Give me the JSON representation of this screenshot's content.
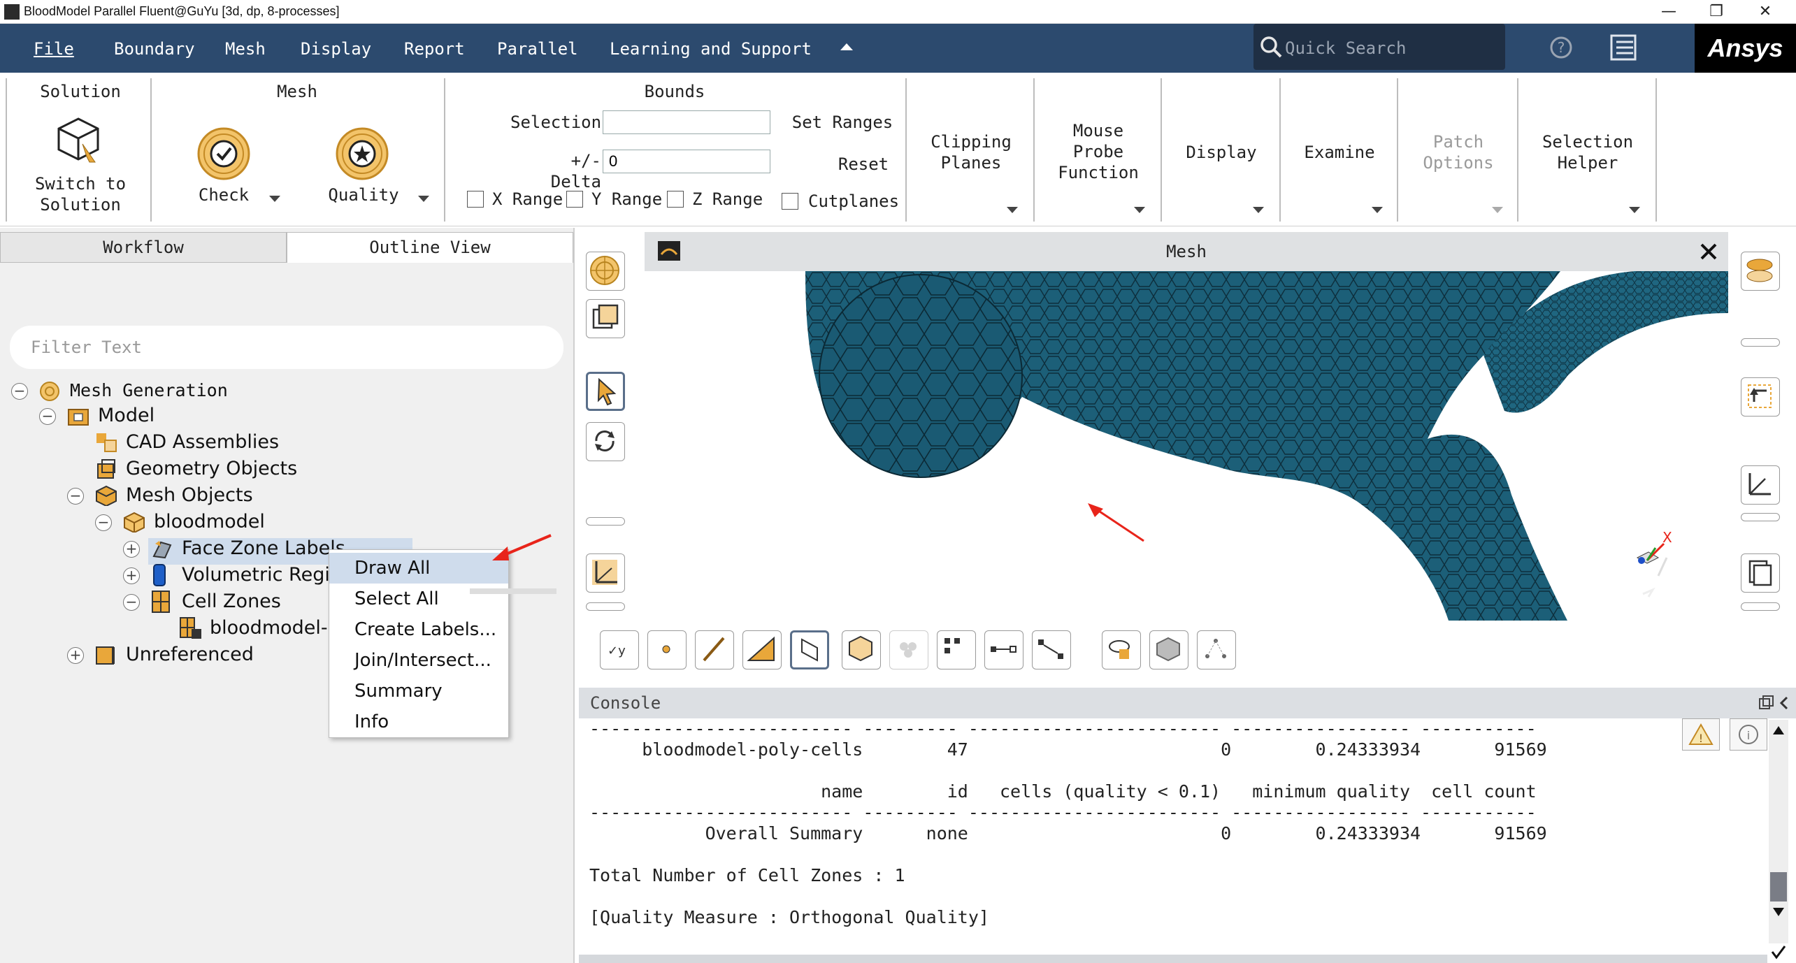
{
  "window": {
    "title": "BloodModel Parallel Fluent@GuYu  [3d, dp, 8-processes]",
    "minimize": "—",
    "maximize": "❐",
    "close": "✕"
  },
  "menu": {
    "items": [
      "File",
      "Boundary",
      "Mesh",
      "Display",
      "Report",
      "Parallel",
      "Learning and Support"
    ],
    "search_placeholder": "Quick Search",
    "brand": "Ansys"
  },
  "ribbon": {
    "solution": {
      "title": "Solution",
      "button": "Switch to\nSolution"
    },
    "mesh": {
      "title": "Mesh",
      "check": "Check",
      "quality": "Quality"
    },
    "bounds": {
      "title": "Bounds",
      "selection_label": "Selection",
      "selection_value": "",
      "delta_label": "+/- Delta",
      "delta_value": "0",
      "set_ranges": "Set Ranges",
      "reset": "Reset",
      "x_range": "X Range",
      "y_range": "Y Range",
      "z_range": "Z Range",
      "cutplanes": "Cutplanes"
    },
    "clipping": "Clipping\nPlanes",
    "mouse_probe": "Mouse\nProbe\nFunction",
    "display": "Display",
    "examine": "Examine",
    "patch": "Patch\nOptions",
    "selection_helper": "Selection\nHelper"
  },
  "left": {
    "tabs": [
      "Workflow",
      "Outline View"
    ],
    "filter_placeholder": "Filter Text",
    "tree": {
      "mesh_generation": "Mesh Generation",
      "model": "Model",
      "cad": "CAD Assemblies",
      "geometry": "Geometry Objects",
      "mesh_objects": "Mesh Objects",
      "bloodmodel": "bloodmodel",
      "face_zone_labels": "Face Zone Labels",
      "volumetric": "Volumetric Regic",
      "cell_zones": "Cell Zones",
      "bloodmodel_p": "bloodmodel-p",
      "unreferenced": "Unreferenced"
    }
  },
  "context_menu": {
    "items": [
      "Draw All",
      "Select All",
      "Create Labels...",
      "Join/Intersect...",
      "Summary",
      "Info"
    ]
  },
  "graphics": {
    "title": "Mesh",
    "mesh_color": "#1c5f78"
  },
  "console": {
    "title": "Console",
    "lines": [
      "------------------------- --------- ------------------------ ----------------- -----------",
      "     bloodmodel-poly-cells        47                        0        0.24333934       91569",
      "",
      "                      name        id   cells (quality < 0.1)   minimum quality  cell count",
      "------------------------- --------- ------------------------ ----------------- -----------",
      "           Overall Summary      none                        0        0.24333934       91569",
      "",
      "Total Number of Cell Zones : 1",
      "",
      "[Quality Measure : Orthogonal Quality]"
    ]
  },
  "colors": {
    "menubar": "#2c4a6e",
    "accent": "#e8241a"
  }
}
